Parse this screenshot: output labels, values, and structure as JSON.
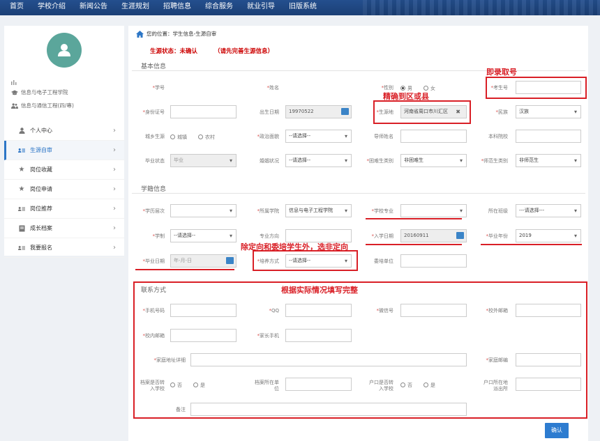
{
  "topnav": {
    "items": [
      "首页",
      "学校介绍",
      "新闻公告",
      "生涯规划",
      "招聘信息",
      "综合服务",
      "就业引导",
      "旧版系统"
    ]
  },
  "sidebar": {
    "college": "信息与电子工程学院",
    "major": "信息与通信工程(四/專)",
    "menu": [
      "个人中心",
      "生源自审",
      "岗位收藏",
      "岗位申请",
      "岗位推荐",
      "成长档案",
      "我要报名"
    ]
  },
  "breadcrumb": "您的位置：学生信息-生源自审",
  "status": {
    "text": "生源状态：未确认",
    "hint": "（请先完善生源信息）"
  },
  "sections": {
    "basic": "基本信息",
    "school": "学籍信息",
    "contact": "联系方式"
  },
  "basic": {
    "student_id": "学号",
    "name": "姓名",
    "gender": "性别",
    "gender_male": "男",
    "gender_female": "女",
    "exam_no": "考生号",
    "id_card": "身份证号",
    "birth": "出生日期",
    "birth_value": "19970522",
    "origin": "生源地",
    "origin_value": "河南省周口市川汇区",
    "ethnic": "民族",
    "ethnic_value": "汉族",
    "urban_rural": "城乡生源",
    "urban": "城镇",
    "rural": "农村",
    "political": "政治面貌",
    "select_placeholder": "--请选择--",
    "tutor": "导师姓名",
    "undergrad_school": "本科院校",
    "grad_status": "毕业状态",
    "grad_status_value": "毕业",
    "marital": "婚姻状况",
    "hardship": "困难生类别",
    "hardship_value": "非困难生",
    "normal": "师范生类别",
    "normal_value": "非师范生"
  },
  "school": {
    "level": "学历层次",
    "college": "所属学院",
    "college_value": "信息与电子工程学院",
    "major": "学校专业",
    "class": "所在班级",
    "class_placeholder": "---请选择---",
    "duration": "学制",
    "direction": "专业方向",
    "enroll": "入学日期",
    "enroll_value": "20160911",
    "grad_year": "毕业年份",
    "grad_year_value": "2019",
    "grad_date": "毕业日期",
    "grad_date_placeholder": "年-月-日",
    "train_mode": "培养方式",
    "entrust": "委培单位"
  },
  "contact": {
    "mobile": "手机号码",
    "qq": "QQ",
    "wechat": "微信号",
    "ext_email": "校外邮箱",
    "int_email": "校内邮箱",
    "parent_mobile": "家长手机",
    "address": "家庭地址详细",
    "postcode": "家庭邮编",
    "archive_transfer_1": "档案是否转",
    "archive_transfer_2": "入学校",
    "archive_unit_1": "档案所在单",
    "archive_unit_2": "位",
    "hukou_transfer_1": "户口是否转",
    "hukou_transfer_2": "入学校",
    "hukou_station_1": "户口所在地",
    "hukou_station_2": "派出所",
    "no": "否",
    "yes": "是",
    "remark": "备注"
  },
  "annotations": {
    "exam_no": "即录取号",
    "origin": "精确到区或县",
    "train": "除定向和委培学生外，选非定向",
    "contact": "根据实际情况填写完整"
  },
  "submit": "确认",
  "colors": {
    "nav": "#1f4680",
    "accent": "#2d76c6",
    "annotation": "#d91f26",
    "avatar": "#5ba69b"
  }
}
